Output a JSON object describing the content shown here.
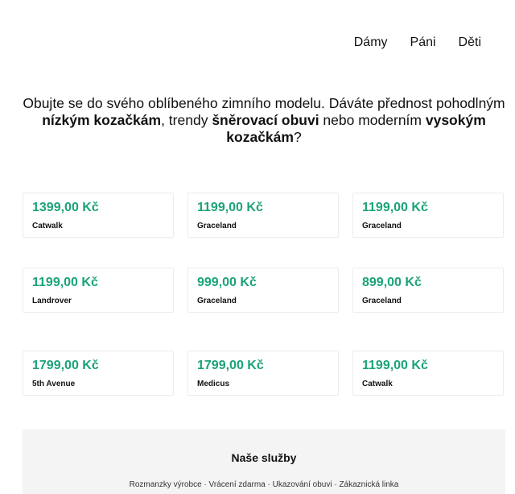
{
  "nav": {
    "items": [
      {
        "label": "Dámy"
      },
      {
        "label": "Páni"
      },
      {
        "label": "Děti"
      }
    ]
  },
  "intro": {
    "part1": "Obujte se do svého oblíbeného zimního modelu. Dáváte přednost pohodlným ",
    "bold1": "nízkým kozačkám",
    "part2": ", trendy ",
    "bold2": "šněrovací obuvi",
    "part3": " nebo moderním ",
    "bold3": "vysokým kozačkám",
    "part4": "?"
  },
  "products": [
    {
      "price": "1399,00 Kč",
      "brand": "Catwalk"
    },
    {
      "price": "1199,00 Kč",
      "brand": "Graceland"
    },
    {
      "price": "1199,00 Kč",
      "brand": "Graceland"
    },
    {
      "price": "1199,00 Kč",
      "brand": "Landrover"
    },
    {
      "price": "999,00 Kč",
      "brand": "Graceland"
    },
    {
      "price": "899,00 Kč",
      "brand": "Graceland"
    },
    {
      "price": "1799,00 Kč",
      "brand": "5th Avenue"
    },
    {
      "price": "1799,00 Kč",
      "brand": "Medicus"
    },
    {
      "price": "1199,00 Kč",
      "brand": "Catwalk"
    }
  ],
  "services": {
    "title": "Naše služby",
    "text": "Rozmanzky výrobce · Vrácení zdarma · Ukazování obuvi · Zákaznická linka"
  },
  "colors": {
    "price": "#1aa37a",
    "services_bg": "#f4f4f4"
  }
}
